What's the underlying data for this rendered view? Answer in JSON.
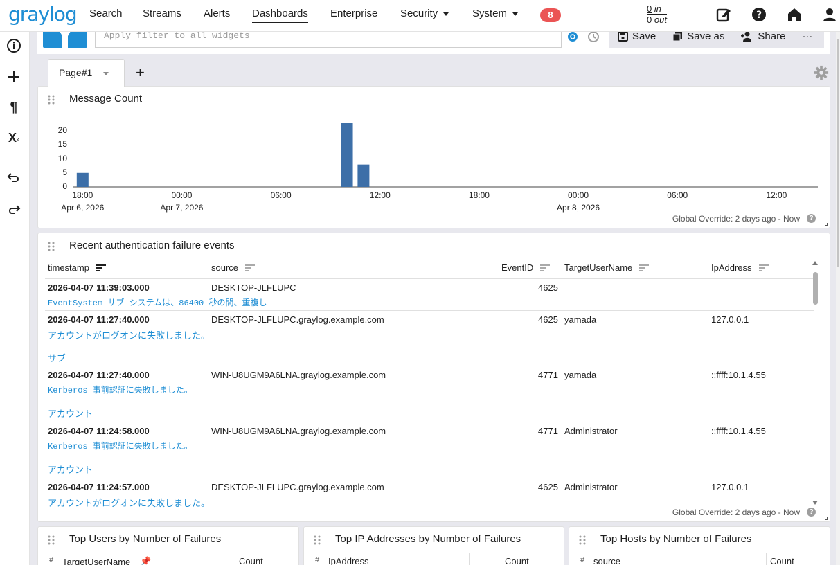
{
  "nav": {
    "logo": "graylog",
    "items": [
      {
        "label": "Search"
      },
      {
        "label": "Streams"
      },
      {
        "label": "Alerts"
      },
      {
        "label": "Dashboards"
      },
      {
        "label": "Enterprise"
      },
      {
        "label": "Security"
      },
      {
        "label": "System"
      }
    ],
    "notification_count": "8",
    "throughput_in_num": "0",
    "throughput_in_label": "in",
    "throughput_out_num": "0",
    "throughput_out_label": "out",
    "icons": [
      "edit-icon",
      "help-icon",
      "home-icon",
      "user-icon"
    ]
  },
  "sidebar": {
    "icons": [
      "info-icon",
      "plus-icon",
      "pilcrow-icon",
      "subscript-x-icon",
      "undo-icon",
      "redo-icon"
    ]
  },
  "filter": {
    "placeholder": "Apply filter to all widgets"
  },
  "toolbar": {
    "save_label": "Save",
    "save_as_label": "Save as",
    "share_label": "Share",
    "more_label": "···"
  },
  "tabs": {
    "page_label": "Page#1",
    "add_label": "+"
  },
  "message_count": {
    "title": "Message Count",
    "footer": "Global Override: 2 days ago - Now"
  },
  "chart_data": {
    "type": "bar",
    "title": "Message Count",
    "xlabel": "",
    "ylabel": "",
    "ylim": [
      0,
      23
    ],
    "y_ticks": [
      "0",
      "5",
      "10",
      "15",
      "20"
    ],
    "x_ticks": [
      {
        "time": "18:00",
        "date": "Apr 6, 2026"
      },
      {
        "time": "00:00",
        "date": "Apr 7, 2026"
      },
      {
        "time": "06:00",
        "date": ""
      },
      {
        "time": "12:00",
        "date": ""
      },
      {
        "time": "18:00",
        "date": ""
      },
      {
        "time": "00:00",
        "date": "Apr 8, 2026"
      },
      {
        "time": "06:00",
        "date": ""
      },
      {
        "time": "12:00",
        "date": ""
      }
    ],
    "x_range_hours": [
      -0.6,
      44.5
    ],
    "bars": [
      {
        "x_hour": 0.0,
        "value": 5
      },
      {
        "x_hour": 16.0,
        "value": 23
      },
      {
        "x_hour": 17.0,
        "value": 8
      }
    ],
    "bar_color": "#3d6fa8",
    "grid": false
  },
  "auth_events": {
    "title": "Recent authentication failure events",
    "footer": "Global Override: 2 days ago - Now",
    "columns": [
      "timestamp",
      "source",
      "EventID",
      "TargetUserName",
      "IpAddress"
    ],
    "rows": [
      {
        "timestamp": "2026-04-07 11:39:03.000",
        "source": "DESKTOP-JLFLUPC",
        "event_id": "4625",
        "user": "",
        "ip": "",
        "msg1": "EventSystem サブ システムは、86400 秒の間、重複し",
        "msg1_mono": true,
        "msg2": ""
      },
      {
        "timestamp": "2026-04-07 11:27:40.000",
        "source": "DESKTOP-JLFLUPC.graylog.example.com",
        "event_id": "4625",
        "user": "yamada",
        "ip": "127.0.0.1",
        "msg1": "アカウントがログオンに失敗しました。",
        "msg1_mono": false,
        "msg2": "サブ"
      },
      {
        "timestamp": "2026-04-07 11:27:40.000",
        "source": "WIN-U8UGM9A6LNA.graylog.example.com",
        "event_id": "4771",
        "user": "yamada",
        "ip": "::ffff:10.1.4.55",
        "msg1": "Kerberos 事前認証に失敗しました。",
        "msg1_mono": true,
        "msg2": "アカウント"
      },
      {
        "timestamp": "2026-04-07 11:24:58.000",
        "source": "WIN-U8UGM9A6LNA.graylog.example.com",
        "event_id": "4771",
        "user": "Administrator",
        "ip": "::ffff:10.1.4.55",
        "msg1": "Kerberos 事前認証に失敗しました。",
        "msg1_mono": true,
        "msg2": "アカウント"
      },
      {
        "timestamp": "2026-04-07 11:24:57.000",
        "source": "DESKTOP-JLFLUPC.graylog.example.com",
        "event_id": "4625",
        "user": "Administrator",
        "ip": "127.0.0.1",
        "msg1": "アカウントがログオンに失敗しました。",
        "msg1_mono": false,
        "msg2": ""
      }
    ]
  },
  "top_users": {
    "title": "Top Users by Number of Failures",
    "col_hash": "#",
    "col_field": "TargetUserName",
    "col_count": "Count"
  },
  "top_ips": {
    "title": "Top IP Addresses by Number of Failures",
    "col_hash": "#",
    "col_field": "IpAddress",
    "col_count": "Count"
  },
  "top_hosts": {
    "title": "Top Hosts by Number of Failures",
    "col_hash": "#",
    "col_field": "source",
    "col_count": "Count"
  },
  "colors": {
    "accent": "#1f8ed4",
    "badge": "#eb5454",
    "bar": "#3d6fa8"
  }
}
